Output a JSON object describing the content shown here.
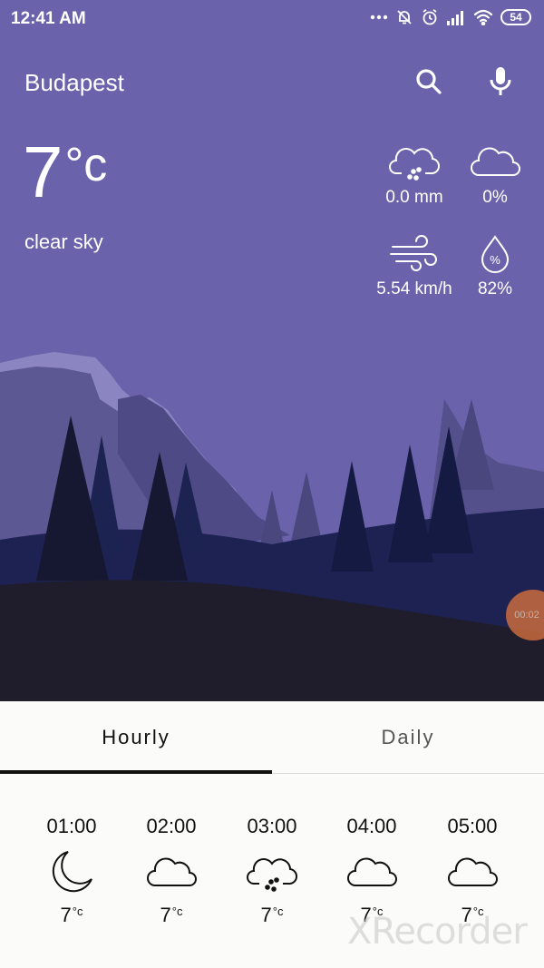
{
  "status_bar": {
    "time": "12:41 AM",
    "battery": "54"
  },
  "header": {
    "city": "Budapest"
  },
  "current": {
    "temperature": "7",
    "unit": "°c",
    "condition": "clear sky",
    "precipitation": "0.0 mm",
    "cloudiness": "0%",
    "wind": "5.54 km/h",
    "humidity": "82%"
  },
  "recording_badge": "00:02",
  "tabs": {
    "hourly": "Hourly",
    "daily": "Daily",
    "active": "Hourly"
  },
  "hourly": [
    {
      "time": "01:00",
      "icon": "moon-icon",
      "temp": "7",
      "unit": "°c"
    },
    {
      "time": "02:00",
      "icon": "cloud-icon",
      "temp": "7",
      "unit": "°c"
    },
    {
      "time": "03:00",
      "icon": "rain-cloud-icon",
      "temp": "7",
      "unit": "°c"
    },
    {
      "time": "04:00",
      "icon": "cloud-icon",
      "temp": "7",
      "unit": "°c"
    },
    {
      "time": "05:00",
      "icon": "cloud-icon",
      "temp": "7",
      "unit": "°c"
    }
  ],
  "watermark": "XRecorder",
  "colors": {
    "sky": "#6a63ab",
    "ground": "#1f1d2b",
    "tab_background": "#fbfcfa",
    "tab_indicator": "#111111"
  }
}
